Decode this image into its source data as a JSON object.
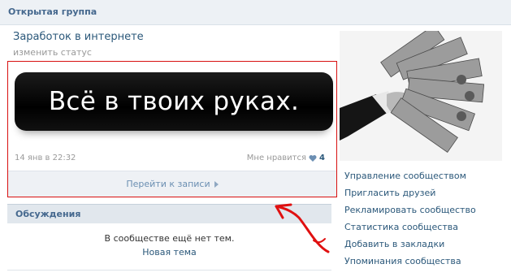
{
  "header": {
    "title": "Открытая группа"
  },
  "group": {
    "name": "Заработок в интернете",
    "change_status": "изменить статус"
  },
  "post": {
    "banner_text": "Всё в твоих руках.",
    "date": "14 янв в 22:32",
    "like_label": "Мне нравится",
    "like_count": "4",
    "goto_label": "Перейти к записи"
  },
  "discussions": {
    "title": "Обсуждения",
    "empty_text": "В сообществе ещё нет тем.",
    "new_topic": "Новая тема"
  },
  "menu": {
    "items": [
      "Управление сообществом",
      "Пригласить друзей",
      "Рекламировать сообщество",
      "Статистика сообщества",
      "Добавить в закладки",
      "Упоминания сообщества"
    ]
  },
  "colors": {
    "link": "#2b587a",
    "header_bg": "#edf1f5",
    "highlight": "#d81010"
  }
}
